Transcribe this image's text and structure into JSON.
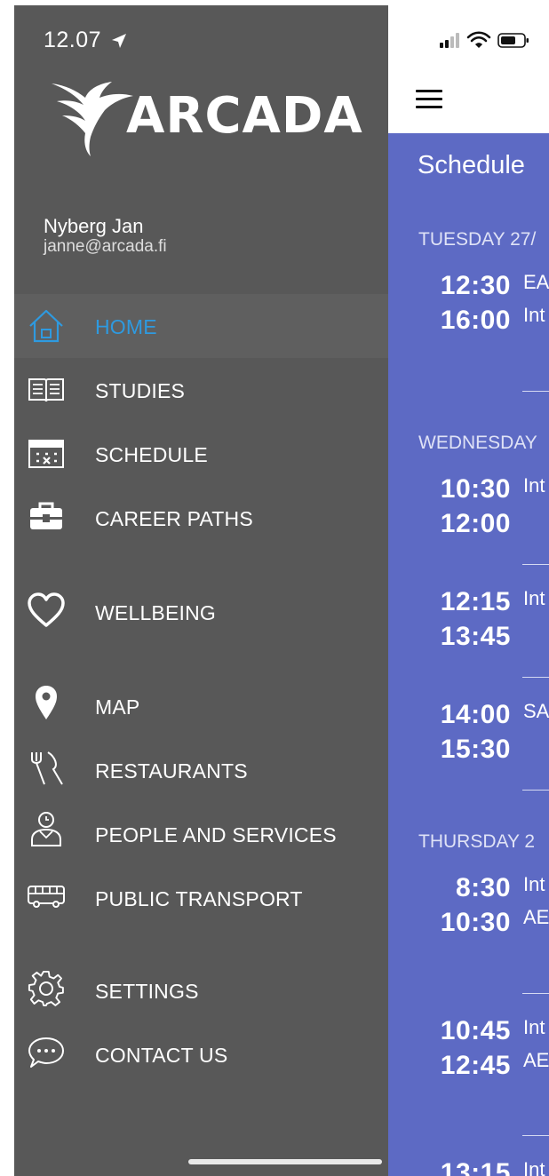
{
  "drawer": {
    "clock": "12.07",
    "logo_text": "ARCADA",
    "user": {
      "name": "Nyberg Jan",
      "email": "janne@arcada.fi"
    },
    "active_color": "#2e9ae0",
    "menu": [
      {
        "label": "HOME",
        "icon": "home-icon",
        "active": true
      },
      {
        "label": "STUDIES",
        "icon": "book-icon"
      },
      {
        "label": "SCHEDULE",
        "icon": "calendar-icon"
      },
      {
        "label": "CAREER PATHS",
        "icon": "briefcase-icon"
      },
      {
        "label": "WELLBEING",
        "icon": "heart-icon"
      },
      {
        "label": "MAP",
        "icon": "map-pin-icon"
      },
      {
        "label": "RESTAURANTS",
        "icon": "fork-knife-icon"
      },
      {
        "label": "PEOPLE AND SERVICES",
        "icon": "person-icon"
      },
      {
        "label": "PUBLIC TRANSPORT",
        "icon": "bus-icon"
      },
      {
        "label": "SETTINGS",
        "icon": "gear-icon"
      },
      {
        "label": "CONTACT US",
        "icon": "chat-bubble-icon"
      }
    ]
  },
  "schedule": {
    "title": "Schedule",
    "accent_color": "#5d6ac4",
    "days": [
      {
        "header": "TUESDAY 27/",
        "events": [
          {
            "start": "12:30",
            "end": "16:00",
            "title": "EA",
            "sub": "Int"
          }
        ]
      },
      {
        "header": "WEDNESDAY",
        "events": [
          {
            "start": "10:30",
            "end": "12:00",
            "title": "Int",
            "sub": ""
          },
          {
            "start": "12:15",
            "end": "13:45",
            "title": "Int",
            "sub": ""
          },
          {
            "start": "14:00",
            "end": "15:30",
            "title": "SA",
            "sub": ""
          }
        ]
      },
      {
        "header": "THURSDAY 2",
        "events": [
          {
            "start": "8:30",
            "end": "10:30",
            "title": "Int",
            "sub": "AE"
          },
          {
            "start": "10:45",
            "end": "12:45",
            "title": "Int",
            "sub": "AE"
          },
          {
            "start": "13:15",
            "end": "",
            "title": "Int",
            "sub": ""
          }
        ]
      }
    ]
  }
}
